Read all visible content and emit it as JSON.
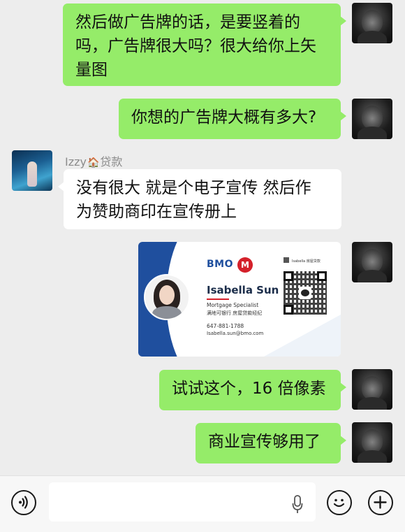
{
  "messages": [
    {
      "sender": "me",
      "text_lines": [
        "然后做广告牌的话，是要竖着的",
        "吗，广告牌很大吗？很大给你上矢",
        "量图"
      ]
    },
    {
      "sender": "me",
      "text": "你想的广告牌大概有多大?"
    },
    {
      "sender": "them",
      "name_prefix": "Izzy",
      "name_icon": "house-icon",
      "name_suffix": "贷款",
      "text_lines": [
        "没有很大 就是个电子宣传 然后作",
        "为赞助商印在宣传册上"
      ]
    },
    {
      "sender": "me",
      "type": "image",
      "card": {
        "bank": "BMO",
        "roundel": "M",
        "name": "Isabella Sun",
        "title": "Mortgage Specialist",
        "title_cn": "满地可银行 房屋贷款经纪",
        "phone": "647-881-1788",
        "email": "Isabella.sun@bmo.com",
        "qr_label": "Isabella 房屋贷款"
      }
    },
    {
      "sender": "me",
      "text": "试试这个，16 倍像素"
    },
    {
      "sender": "me",
      "text": "商业宣传够用了"
    }
  ],
  "input_bar": {
    "text_value": "",
    "icons": [
      "voice-icon",
      "mic-icon",
      "emoji-icon",
      "plus-icon"
    ]
  },
  "colors": {
    "background": "#ededed",
    "my_bubble": "#95ec69",
    "their_bubble": "#ffffff",
    "bmo_blue": "#1f4f9e",
    "bmo_red": "#d4202a"
  }
}
